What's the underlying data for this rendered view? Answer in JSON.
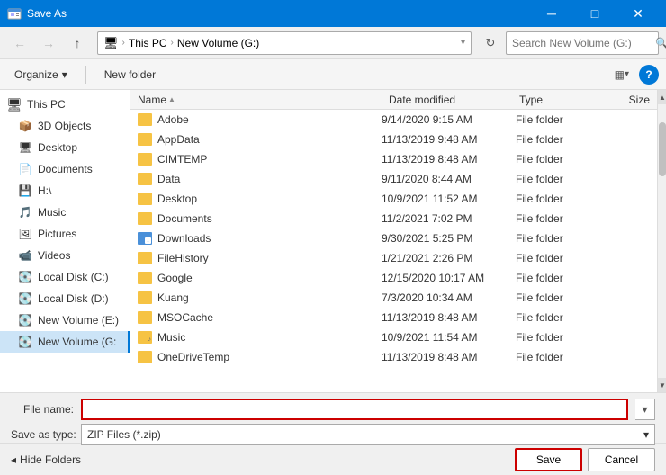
{
  "title": "Save As",
  "window": {
    "title": "Save As",
    "controls": [
      "minimize",
      "maximize",
      "close"
    ]
  },
  "toolbar": {
    "back_disabled": true,
    "forward_disabled": true,
    "up_label": "↑",
    "address": {
      "icon": "🖥",
      "crumbs": [
        "This PC",
        "New Volume (G:)"
      ]
    },
    "search_placeholder": "Search New Volume (G:)"
  },
  "command_bar": {
    "organize_label": "Organize",
    "new_folder_label": "New folder",
    "view_icon": "▦",
    "help_label": "?"
  },
  "sidebar": {
    "items": [
      {
        "id": "this-pc",
        "label": "This PC",
        "icon": "🖥",
        "selected": false
      },
      {
        "id": "3d-objects",
        "label": "3D Objects",
        "icon": "📦",
        "selected": false
      },
      {
        "id": "desktop",
        "label": "Desktop",
        "icon": "🖥",
        "selected": false
      },
      {
        "id": "documents",
        "label": "Documents",
        "icon": "📄",
        "selected": false
      },
      {
        "id": "h-drive",
        "label": "H:\\",
        "icon": "💾",
        "selected": false
      },
      {
        "id": "music",
        "label": "Music",
        "icon": "🎵",
        "selected": false
      },
      {
        "id": "pictures",
        "label": "Pictures",
        "icon": "🖼",
        "selected": false
      },
      {
        "id": "videos",
        "label": "Videos",
        "icon": "📹",
        "selected": false
      },
      {
        "id": "local-c",
        "label": "Local Disk (C:)",
        "icon": "💽",
        "selected": false
      },
      {
        "id": "local-d",
        "label": "Local Disk (D:)",
        "icon": "💽",
        "selected": false
      },
      {
        "id": "new-vol-e",
        "label": "New Volume (E:)",
        "icon": "💽",
        "selected": false
      },
      {
        "id": "new-vol-g",
        "label": "New Volume (G:",
        "icon": "💽",
        "selected": true
      }
    ]
  },
  "file_list": {
    "columns": [
      "Name",
      "Date modified",
      "Type",
      "Size"
    ],
    "files": [
      {
        "name": "Adobe",
        "date": "9/14/2020 9:15 AM",
        "type": "File folder",
        "size": "",
        "icon": "folder"
      },
      {
        "name": "AppData",
        "date": "11/13/2019 9:48 AM",
        "type": "File folder",
        "size": "",
        "icon": "folder"
      },
      {
        "name": "CIMTEMP",
        "date": "11/13/2019 8:48 AM",
        "type": "File folder",
        "size": "",
        "icon": "folder"
      },
      {
        "name": "Data",
        "date": "9/11/2020 8:44 AM",
        "type": "File folder",
        "size": "",
        "icon": "folder"
      },
      {
        "name": "Desktop",
        "date": "10/9/2021 11:52 AM",
        "type": "File folder",
        "size": "",
        "icon": "folder"
      },
      {
        "name": "Documents",
        "date": "11/2/2021 7:02 PM",
        "type": "File folder",
        "size": "",
        "icon": "folder"
      },
      {
        "name": "Downloads",
        "date": "9/30/2021 5:25 PM",
        "type": "File folder",
        "size": "",
        "icon": "folder-download"
      },
      {
        "name": "FileHistory",
        "date": "1/21/2021 2:26 PM",
        "type": "File folder",
        "size": "",
        "icon": "folder"
      },
      {
        "name": "Google",
        "date": "12/15/2020 10:17 AM",
        "type": "File folder",
        "size": "",
        "icon": "folder"
      },
      {
        "name": "Kuang",
        "date": "7/3/2020 10:34 AM",
        "type": "File folder",
        "size": "",
        "icon": "folder"
      },
      {
        "name": "MSOCache",
        "date": "11/13/2019 8:48 AM",
        "type": "File folder",
        "size": "",
        "icon": "folder"
      },
      {
        "name": "Music",
        "date": "10/9/2021 11:54 AM",
        "type": "File folder",
        "size": "",
        "icon": "folder-music"
      },
      {
        "name": "OneDriveTemp",
        "date": "11/13/2019 8:48 AM",
        "type": "File folder",
        "size": "",
        "icon": "folder"
      }
    ]
  },
  "bottom": {
    "filename_label": "File name:",
    "filename_value": "",
    "savetype_label": "Save as type:",
    "savetype_value": "ZIP Files (*.zip)"
  },
  "actions": {
    "hide_folders_label": "Hide Folders",
    "save_label": "Save",
    "cancel_label": "Cancel"
  }
}
